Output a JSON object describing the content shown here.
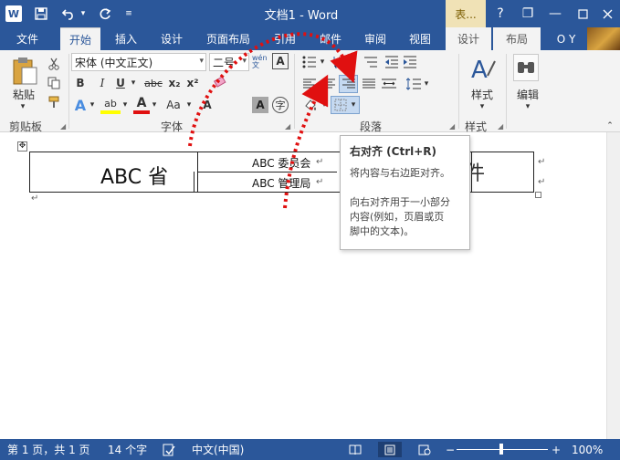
{
  "app": {
    "logo_letter": "W",
    "title": "文档1 - Word",
    "table_tools_tab": "表...",
    "help_symbol": "?",
    "minimize_symbol": "—",
    "restore_symbol": "❐",
    "user_name": "O Y"
  },
  "quick_access": {
    "save_icon": "save-icon",
    "undo_icon": "undo-icon",
    "redo_icon": "redo-icon",
    "customize_icon": "customize-icon"
  },
  "ribbon_tabs": [
    {
      "label": "文件"
    },
    {
      "label": "开始"
    },
    {
      "label": "插入"
    },
    {
      "label": "设计"
    },
    {
      "label": "页面布局"
    },
    {
      "label": "引用"
    },
    {
      "label": "邮件"
    },
    {
      "label": "审阅"
    },
    {
      "label": "视图"
    },
    {
      "label": "设计"
    },
    {
      "label": "布局"
    }
  ],
  "clipboard": {
    "paste_label": "粘贴",
    "group_label": "剪贴板"
  },
  "font": {
    "name": "宋体 (中文正文)",
    "size": "二号",
    "wen_label": "wén 文",
    "bold": "B",
    "italic": "I",
    "underline": "U",
    "strikethrough": "abc",
    "subscript": "x₂",
    "superscript": "x²",
    "text_effects": "A",
    "highlight": "ab",
    "font_color": "A",
    "change_case": "Aa",
    "grow_font": "A",
    "char_shading": "A",
    "enclosed_char": "字",
    "border_char": "A",
    "group_label": "字体"
  },
  "paragraph": {
    "group_label": "段落"
  },
  "styles": {
    "label": "样式",
    "group_label": "样式"
  },
  "editing": {
    "label": "编辑"
  },
  "document": {
    "cell_big": "ABC 省",
    "cell_top": "ABC 委员会",
    "cell_bottom": "ABC 管理局",
    "cell_right_fragment": "件",
    "para_mark": "↵"
  },
  "tooltip": {
    "title": "右对齐 (Ctrl+R)",
    "lines": [
      "将内容与右边距对齐。",
      "",
      "向右对齐用于一小部分",
      "内容(例如，页眉或页",
      "脚中的文本)。"
    ]
  },
  "status": {
    "page_info": "第 1 页，共 1 页",
    "word_count": "14 个字",
    "language": "中文(中国)",
    "zoom_minus": "−",
    "zoom_plus": "+",
    "zoom": "100%"
  },
  "colors": {
    "word_blue": "#2b579a",
    "ribbon_bg": "#f3f3f3",
    "highlight_blue": "#c5d9f1",
    "arrow_red": "#e01010",
    "context_tab": "#f0e2b6"
  }
}
